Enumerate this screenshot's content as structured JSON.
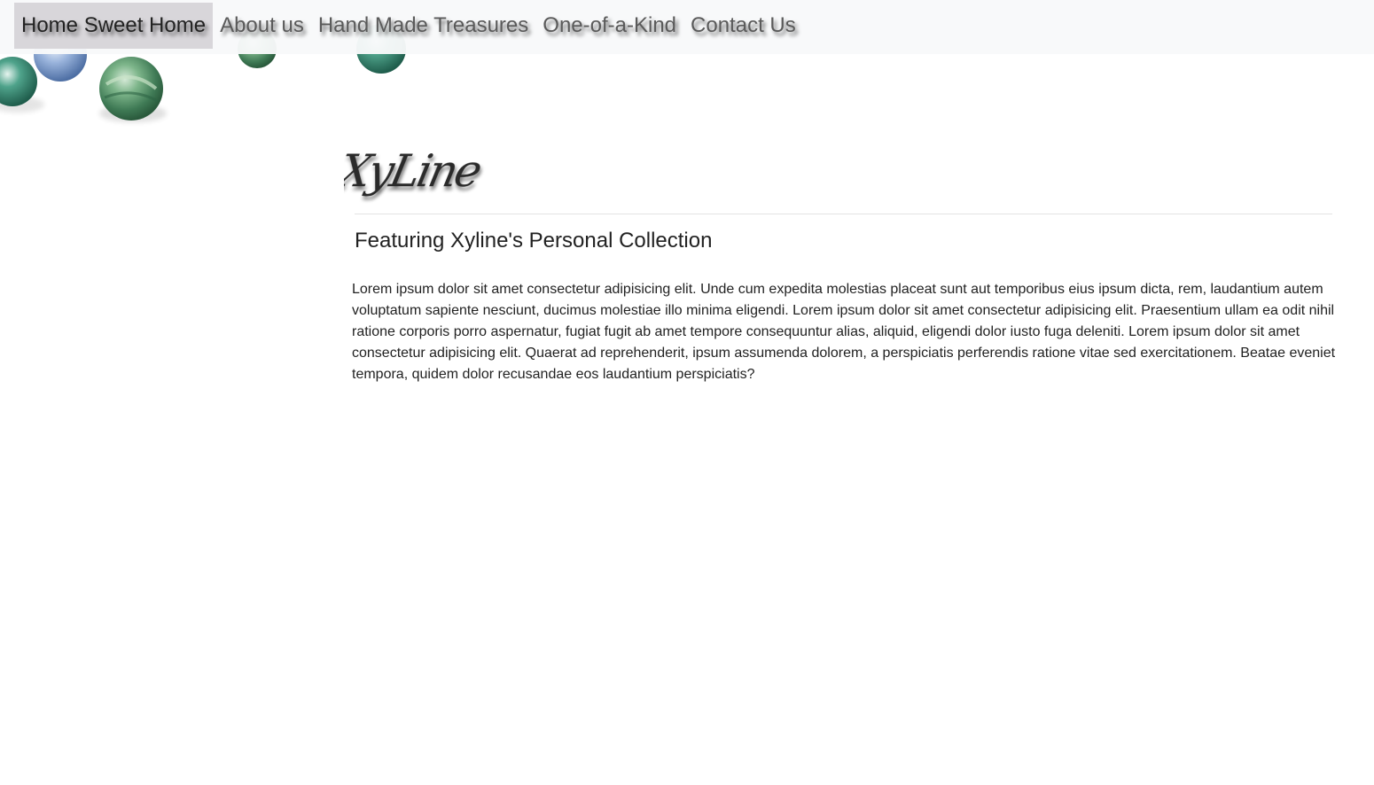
{
  "nav": {
    "items": [
      {
        "label": "Home Sweet Home",
        "active": true
      },
      {
        "label": "About us",
        "active": false
      },
      {
        "label": "Hand Made Treasures",
        "active": false
      },
      {
        "label": "One-of-a-Kind",
        "active": false
      },
      {
        "label": "Contact Us",
        "active": false
      }
    ]
  },
  "brand": {
    "logo_text": "XyLine"
  },
  "main": {
    "heading": "Featuring Xyline's Personal Collection",
    "paragraph": "Lorem ipsum dolor sit amet consectetur adipisicing elit. Unde cum expedita molestias placeat sunt aut temporibus eius ipsum dicta, rem, laudantium autem voluptatum sapiente nesciunt, ducimus molestiae illo minima eligendi. Lorem ipsum dolor sit amet consectetur adipisicing elit. Praesentium ullam ea odit nihil ratione corporis porro aspernatur, fugiat fugit ab amet tempore consequuntur alias, aliquid, eligendi dolor iusto fuga deleniti. Lorem ipsum dolor sit amet consectetur adipisicing elit. Quaerat ad reprehenderit, ipsum assumenda dolorem, a perspiciatis perferendis ratione vitae sed exercitationem. Beatae eveniet tempora, quidem dolor recusandae eos laudantium perspiciatis?"
  },
  "colors": {
    "navbar_bg": "#f8f9fa",
    "active_nav_bg": "#d8d6da",
    "bead_green": "#5a9a6e",
    "bead_blue": "#7d9fc8"
  }
}
